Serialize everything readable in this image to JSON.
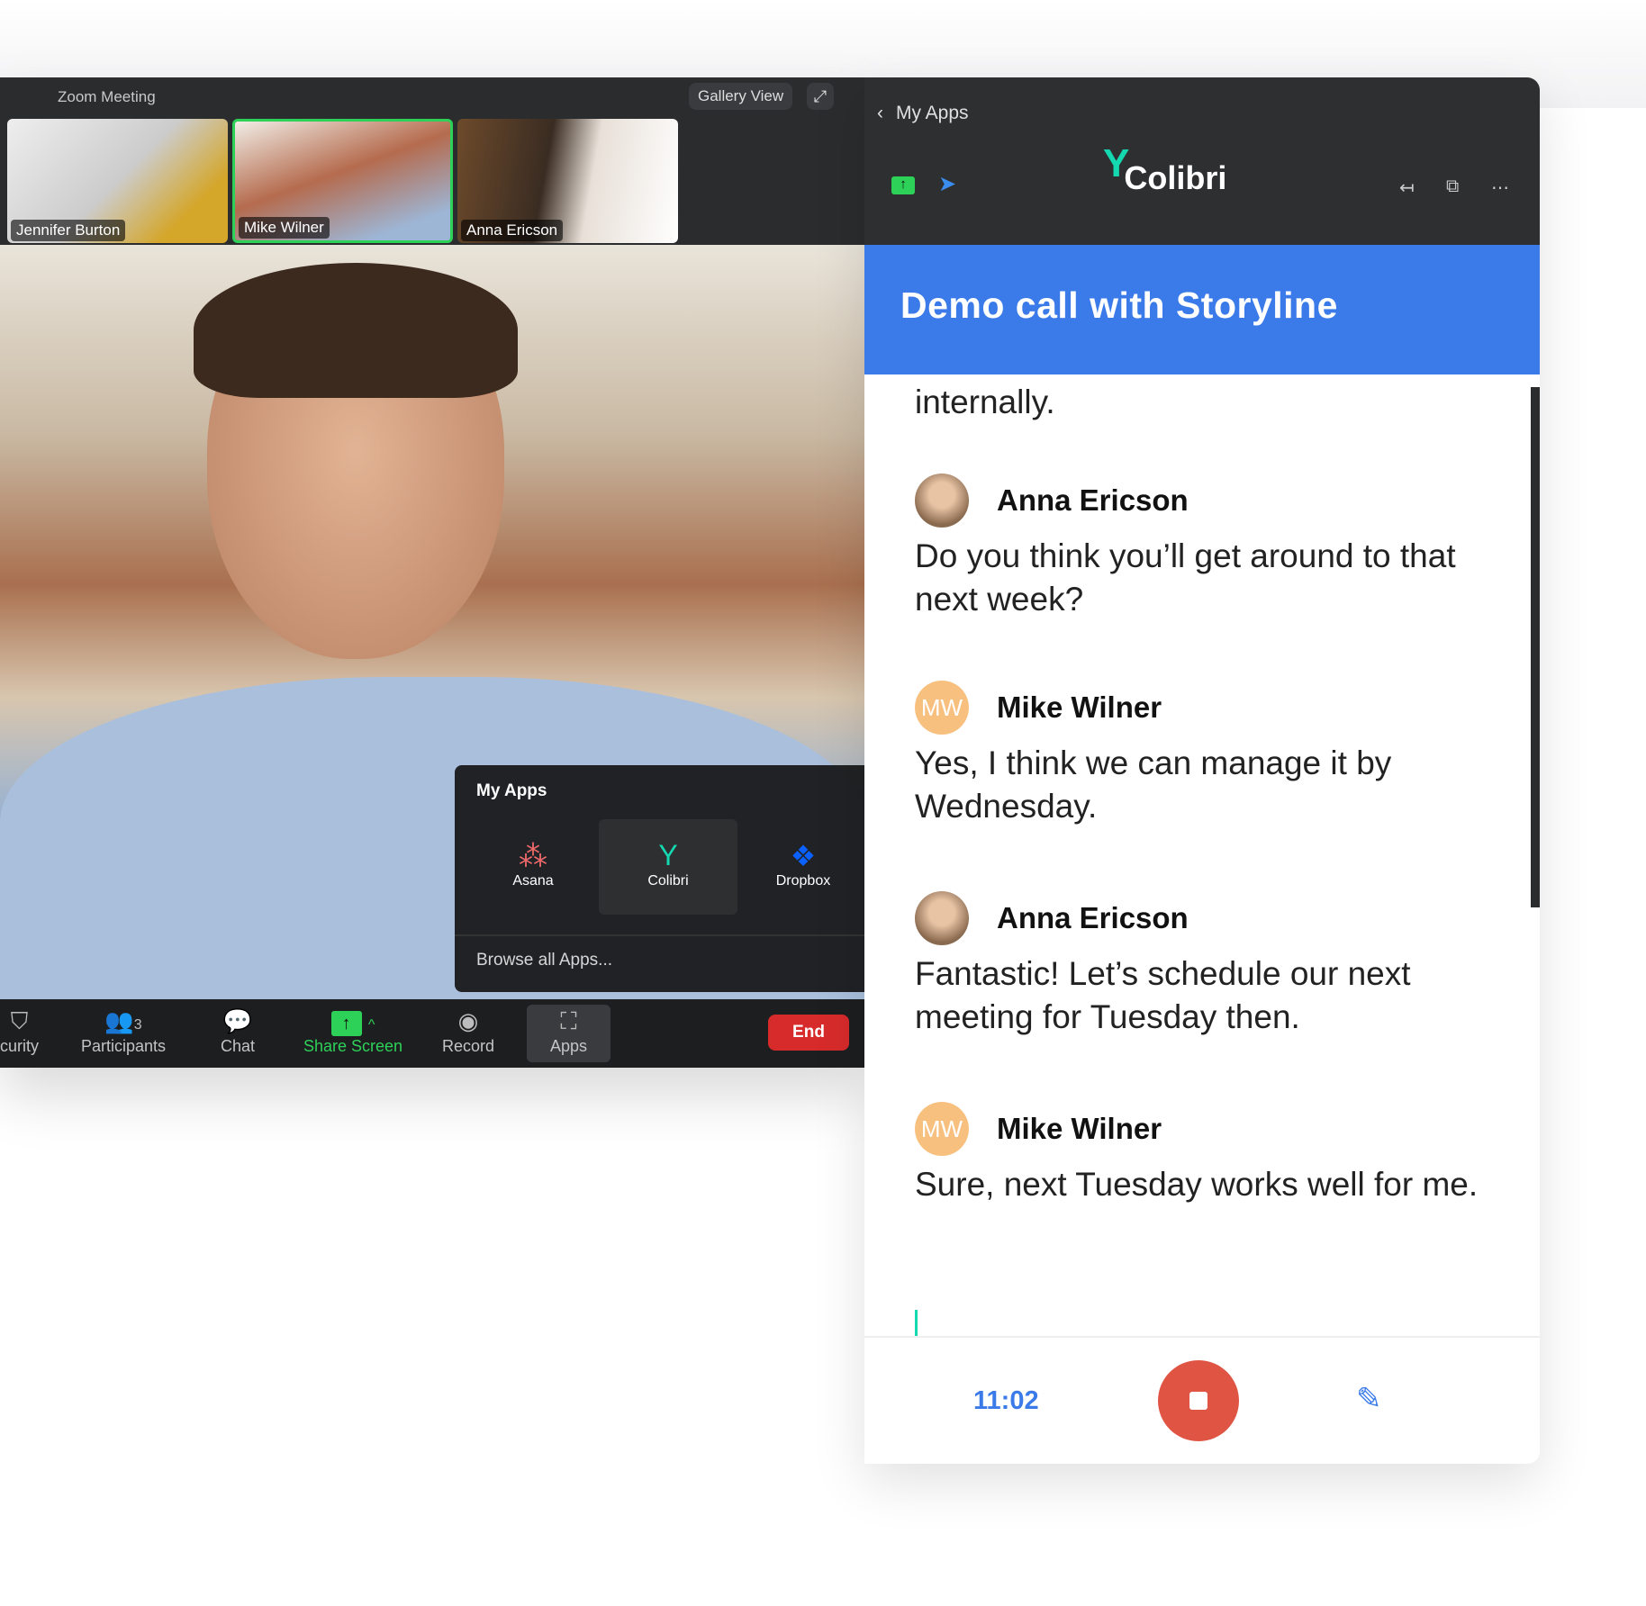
{
  "zoom": {
    "title": "Zoom Meeting",
    "gallery_view": "Gallery View",
    "participants": [
      {
        "name": "Jennifer Burton",
        "active": false
      },
      {
        "name": "Mike Wilner",
        "active": true
      },
      {
        "name": "Anna Ericson",
        "active": false
      }
    ],
    "apps_popup": {
      "title": "My Apps",
      "apps": [
        {
          "label": "Asana",
          "icon": "asana-icon"
        },
        {
          "label": "Colibri",
          "icon": "hummingbird-icon",
          "selected": true
        },
        {
          "label": "Dropbox",
          "icon": "dropbox-icon"
        }
      ],
      "browse": "Browse all Apps..."
    },
    "toolbar": {
      "security": "curity",
      "participants": "Participants",
      "participant_count": "3",
      "chat": "Chat",
      "share": "Share Screen",
      "record": "Record",
      "apps": "Apps",
      "end": "End"
    },
    "colors": {
      "active": "#2ed158",
      "end": "#d72b2b"
    }
  },
  "panel": {
    "back": "My Apps",
    "logo": "Colibri",
    "header": "Demo call with Storyline",
    "partial_text": "internally.",
    "messages": [
      {
        "author": "Anna Ericson",
        "initials": "",
        "text": "Do you think you’ll get around to that next week?"
      },
      {
        "author": "Mike Wilner",
        "initials": "MW",
        "text": "Yes, I think we can manage it by Wednesday."
      },
      {
        "author": "Anna Ericson",
        "initials": "",
        "text": "Fantastic! Let’s schedule our next meeting for Tuesday then."
      },
      {
        "author": "Mike Wilner",
        "initials": "MW",
        "text": "Sure, next Tuesday works well for me."
      }
    ],
    "timer": "11:02",
    "colors": {
      "header": "#3b7be9",
      "record": "#e05443",
      "brand": "#14d9b0"
    }
  }
}
